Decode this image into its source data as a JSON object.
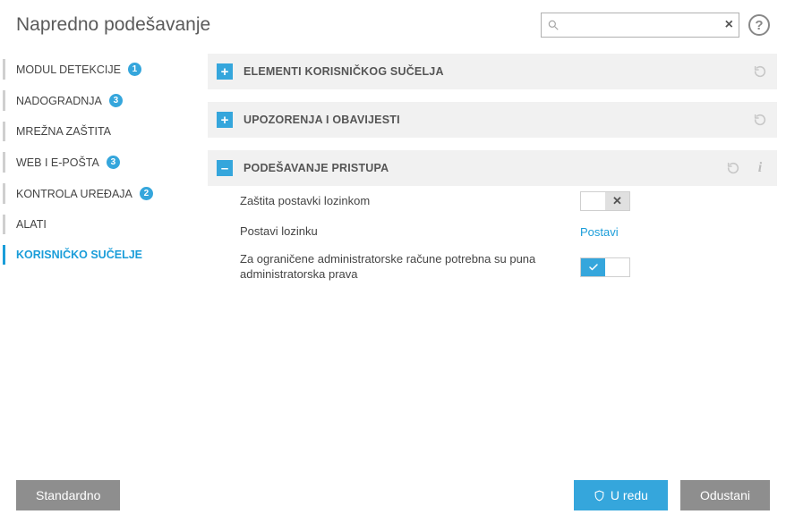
{
  "header": {
    "title": "Napredno podešavanje",
    "search_placeholder": ""
  },
  "sidebar": {
    "items": [
      {
        "label": "MODUL DETEKCIJE",
        "badge": "1"
      },
      {
        "label": "NADOGRADNJA",
        "badge": "3"
      },
      {
        "label": "MREŽNA ZAŠTITA",
        "badge": null
      },
      {
        "label": "WEB I E-POŠTA",
        "badge": "3"
      },
      {
        "label": "KONTROLA UREĐAJA",
        "badge": "2"
      },
      {
        "label": "ALATI",
        "badge": null
      },
      {
        "label": "KORISNIČKO SUČELJE",
        "badge": null
      }
    ],
    "active_index": 6
  },
  "sections": {
    "ui_elements": {
      "title": "ELEMENTI KORISNIČKOG SUČELJA",
      "expanded": false
    },
    "alerts": {
      "title": "UPOZORENJA I OBAVIJESTI",
      "expanded": false
    },
    "access": {
      "title": "PODEŠAVANJE PRISTUPA",
      "expanded": true,
      "rows": {
        "pw_protect": {
          "label": "Zaštita postavki lozinkom",
          "value": false
        },
        "set_pw": {
          "label": "Postavi lozinku",
          "action": "Postavi"
        },
        "full_admin": {
          "label": "Za ograničene administratorske račune potrebna su puna administratorska prava",
          "value": true
        }
      }
    }
  },
  "footer": {
    "default": "Standardno",
    "ok": "U redu",
    "cancel": "Odustani"
  }
}
